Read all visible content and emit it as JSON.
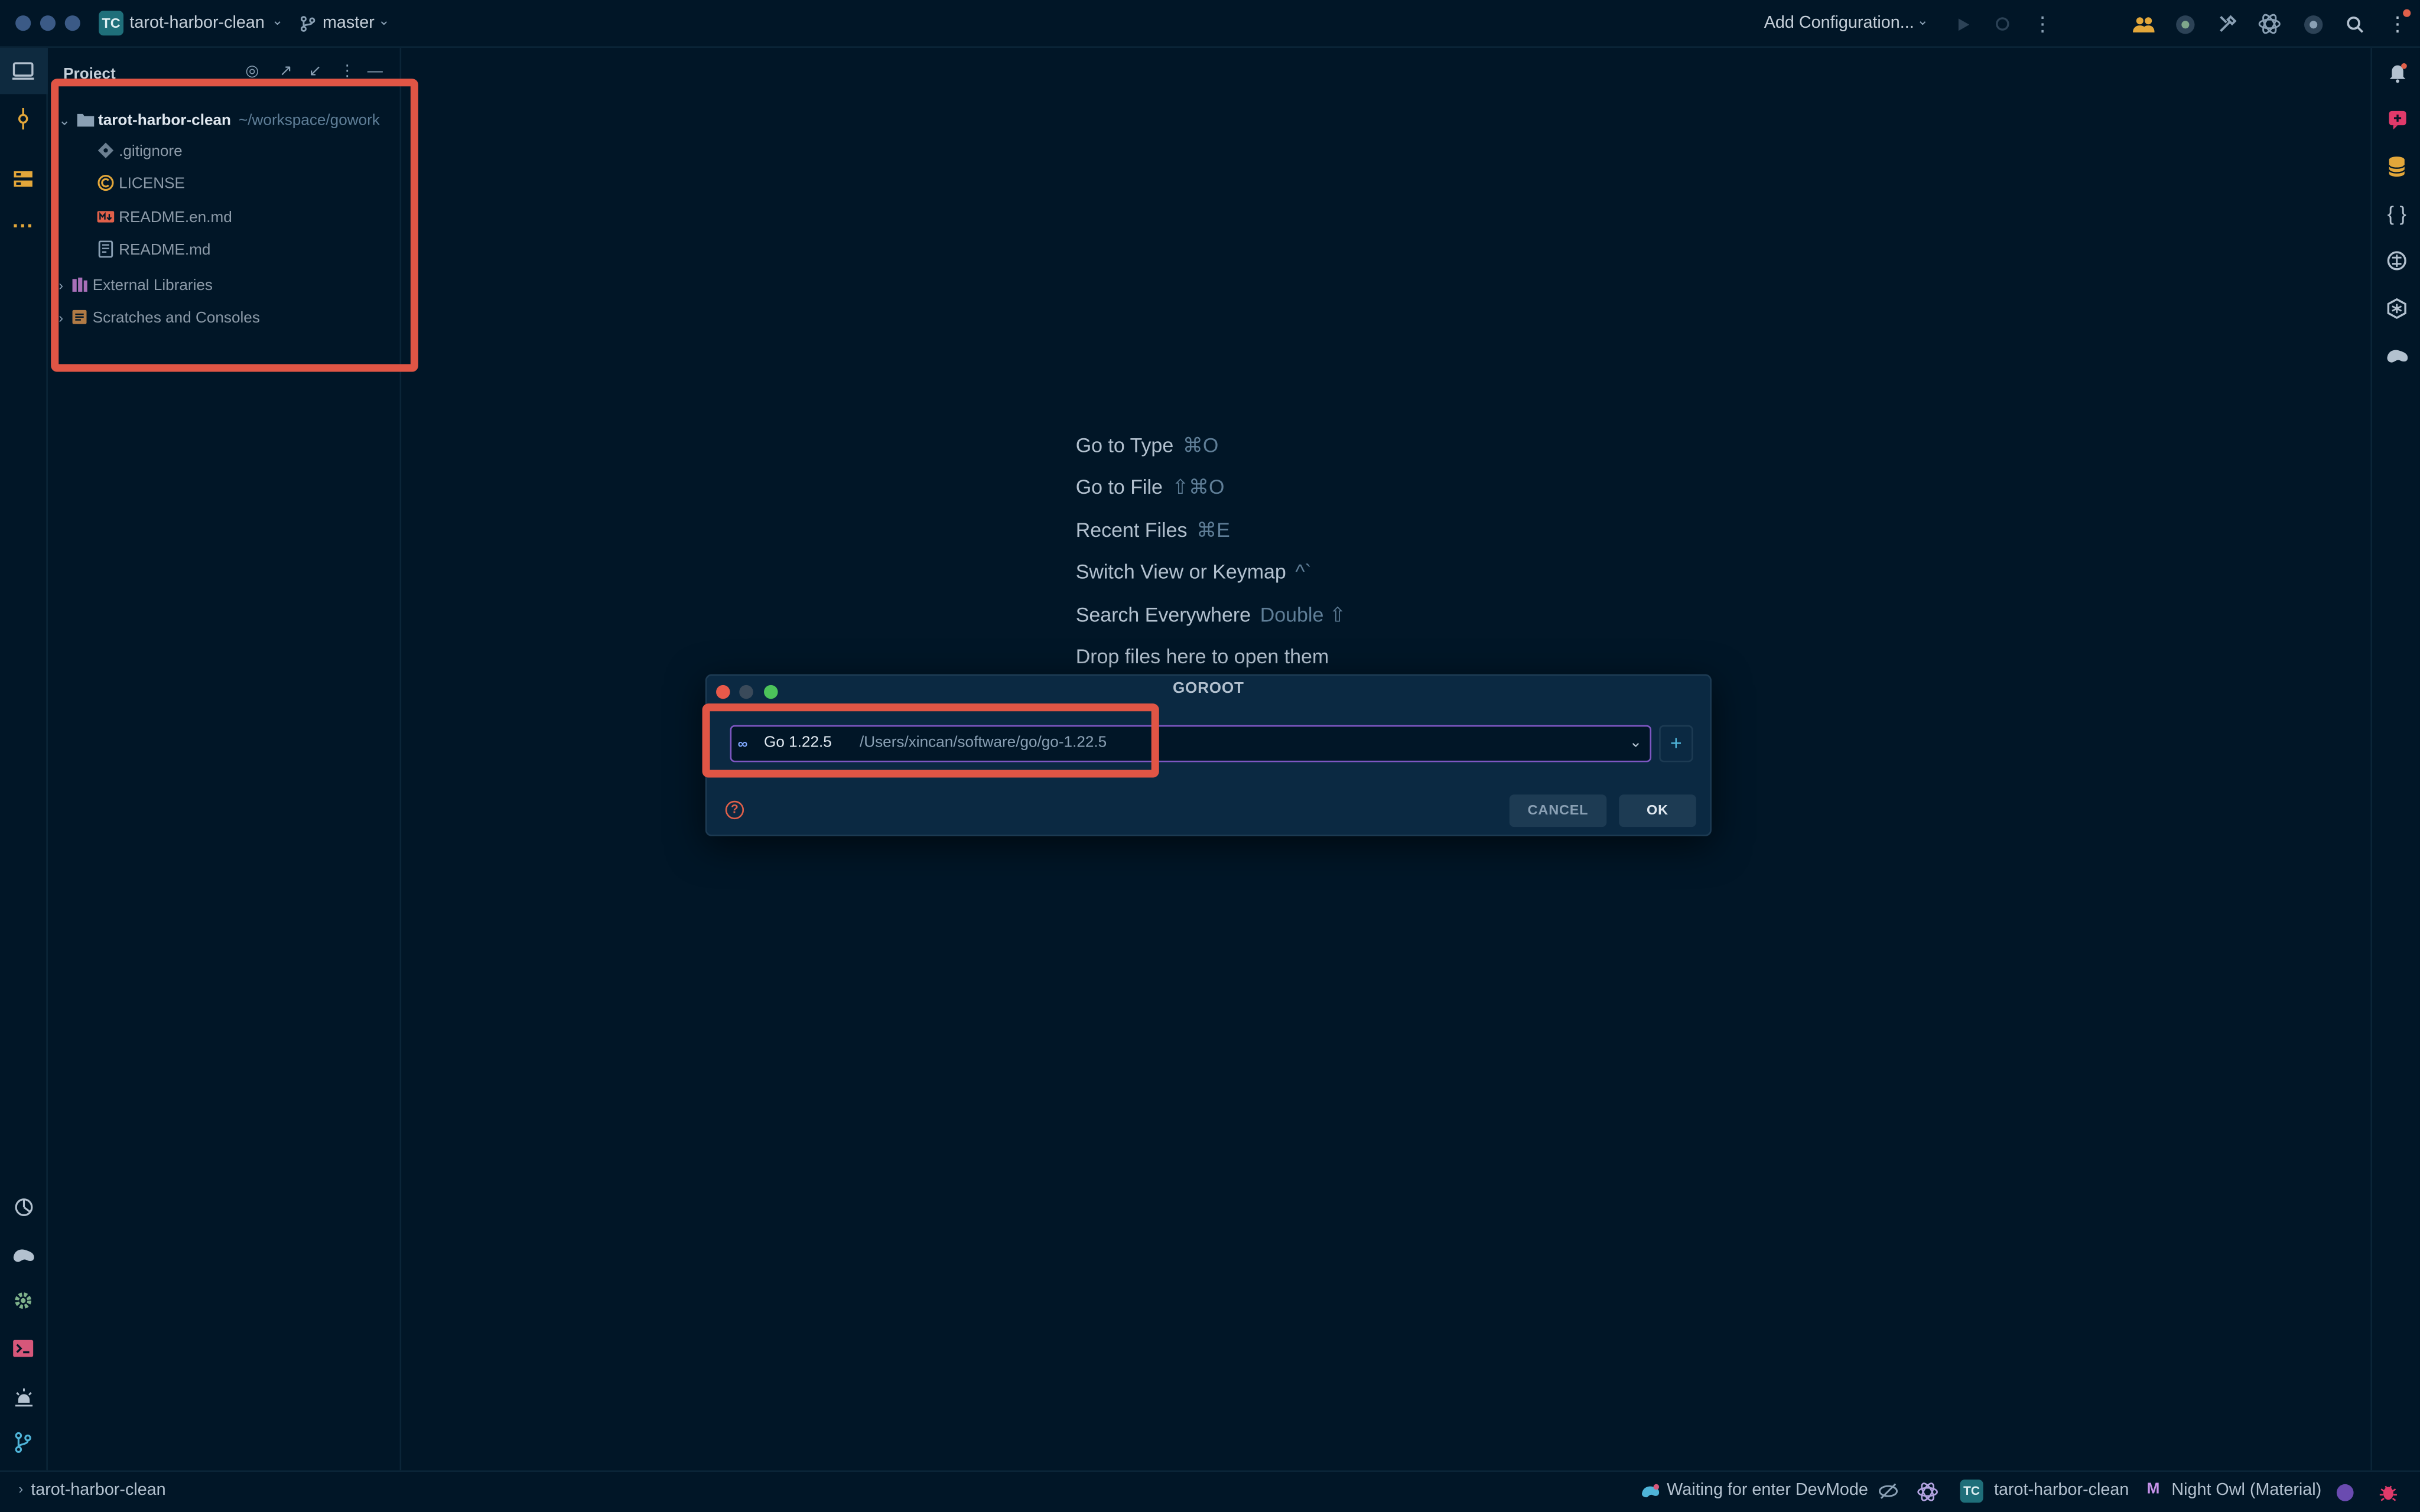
{
  "titlebar": {
    "project_badge": "TC",
    "project_name": "tarot-harbor-clean",
    "branch": "master",
    "run_config": "Add Configuration..."
  },
  "project_panel": {
    "header": "Project",
    "root": {
      "name": "tarot-harbor-clean",
      "path": "~/workspace/gowork"
    },
    "files": [
      {
        "name": ".gitignore",
        "icon": "gitignore-icon"
      },
      {
        "name": "LICENSE",
        "icon": "license-icon"
      },
      {
        "name": "README.en.md",
        "icon": "markdown-icon"
      },
      {
        "name": "README.md",
        "icon": "readme-icon"
      }
    ],
    "external_libraries": "External Libraries",
    "scratches": "Scratches and Consoles"
  },
  "welcome": {
    "items": [
      {
        "label": "Go to Type",
        "shortcut": "⌘O"
      },
      {
        "label": "Go to File",
        "shortcut": "⇧⌘O"
      },
      {
        "label": "Recent Files",
        "shortcut": "⌘E"
      },
      {
        "label": "Switch View or Keymap",
        "shortcut": "^`"
      },
      {
        "label": "Search Everywhere",
        "shortcut": "Double ⇧"
      },
      {
        "label": "Drop files here to open them",
        "shortcut": ""
      }
    ]
  },
  "dialog": {
    "title": "GOROOT",
    "sdk_version": "Go 1.22.5",
    "sdk_path": "/Users/xincan/software/go/go-1.22.5",
    "add_label": "+",
    "cancel_label": "CANCEL",
    "ok_label": "OK"
  },
  "statusbar": {
    "project": "tarot-harbor-clean",
    "devmode": "Waiting for enter DevMode",
    "project_badge": "TC",
    "project_name": "tarot-harbor-clean",
    "theme": "Night Owl (Material)"
  },
  "colors": {
    "background": "#011627",
    "accent_purple": "#7e57c2",
    "highlight_red": "#e05545",
    "badge_teal": "#1f6f7a"
  }
}
